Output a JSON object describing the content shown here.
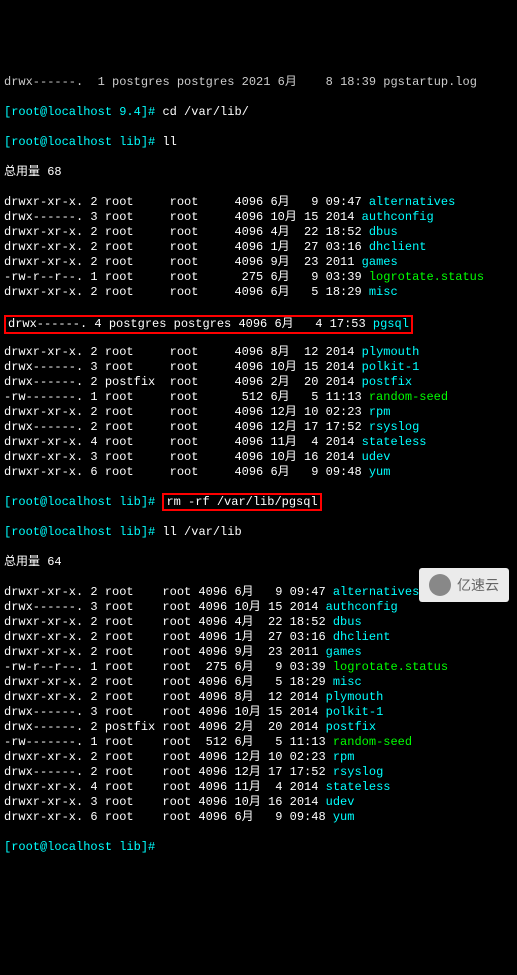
{
  "top_partial": {
    "perm": "drwx------.",
    "n": "1",
    "own": "postgres",
    "grp": "postgres",
    "date": "2021 6月    8 18:39",
    "file": "pgstartup.log"
  },
  "prompts": {
    "p0": "[root@localhost 9.4]#",
    "p1": "[root@localhost lib]#",
    "cmd_cd": "cd /var/lib/",
    "cmd_ll1": "ll",
    "cmd_rm": "rm -rf /var/lib/pgsql",
    "cmd_ll2": "ll /var/lib"
  },
  "totals": {
    "t1": "总用量 68",
    "t2": "总用量 64"
  },
  "list1": [
    {
      "perm": "drwxr-xr-x.",
      "n": "2",
      "own": "root",
      "grp": "root",
      "sz": "4096",
      "date": "6月   9 09:47",
      "file": "alternatives",
      "cls": "cyan"
    },
    {
      "perm": "drwx------.",
      "n": "3",
      "own": "root",
      "grp": "root",
      "sz": "4096",
      "date": "10月 15 2014",
      "file": "authconfig",
      "cls": "cyan"
    },
    {
      "perm": "drwxr-xr-x.",
      "n": "2",
      "own": "root",
      "grp": "root",
      "sz": "4096",
      "date": "4月  22 18:52",
      "file": "dbus",
      "cls": "cyan"
    },
    {
      "perm": "drwxr-xr-x.",
      "n": "2",
      "own": "root",
      "grp": "root",
      "sz": "4096",
      "date": "1月  27 03:16",
      "file": "dhclient",
      "cls": "cyan"
    },
    {
      "perm": "drwxr-xr-x.",
      "n": "2",
      "own": "root",
      "grp": "root",
      "sz": "4096",
      "date": "9月  23 2011",
      "file": "games",
      "cls": "cyan"
    },
    {
      "perm": "-rw-r--r--.",
      "n": "1",
      "own": "root",
      "grp": "root",
      "sz": "275",
      "date": "6月   9 03:39",
      "file": "logrotate.status",
      "cls": "green"
    },
    {
      "perm": "drwxr-xr-x.",
      "n": "2",
      "own": "root",
      "grp": "root",
      "sz": "4096",
      "date": "6月   5 18:29",
      "file": "misc",
      "cls": "cyan"
    }
  ],
  "pgsql": {
    "perm": "drwx------.",
    "n": "4",
    "own": "postgres",
    "grp": "postgres",
    "sz": "4096",
    "date": "6月   4 17:53",
    "file": "pgsql",
    "cls": "cyan"
  },
  "list1b": [
    {
      "perm": "drwxr-xr-x.",
      "n": "2",
      "own": "root",
      "grp": "root",
      "sz": "4096",
      "date": "8月  12 2014",
      "file": "plymouth",
      "cls": "cyan"
    },
    {
      "perm": "drwx------.",
      "n": "3",
      "own": "root",
      "grp": "root",
      "sz": "4096",
      "date": "10月 15 2014",
      "file": "polkit-1",
      "cls": "cyan"
    },
    {
      "perm": "drwx------.",
      "n": "2",
      "own": "postfix",
      "grp": "root",
      "sz": "4096",
      "date": "2月  20 2014",
      "file": "postfix",
      "cls": "cyan"
    },
    {
      "perm": "-rw-------.",
      "n": "1",
      "own": "root",
      "grp": "root",
      "sz": "512",
      "date": "6月   5 11:13",
      "file": "random-seed",
      "cls": "green"
    },
    {
      "perm": "drwxr-xr-x.",
      "n": "2",
      "own": "root",
      "grp": "root",
      "sz": "4096",
      "date": "12月 10 02:23",
      "file": "rpm",
      "cls": "cyan"
    },
    {
      "perm": "drwx------.",
      "n": "2",
      "own": "root",
      "grp": "root",
      "sz": "4096",
      "date": "12月 17 17:52",
      "file": "rsyslog",
      "cls": "cyan"
    },
    {
      "perm": "drwxr-xr-x.",
      "n": "4",
      "own": "root",
      "grp": "root",
      "sz": "4096",
      "date": "11月  4 2014",
      "file": "stateless",
      "cls": "cyan"
    },
    {
      "perm": "drwxr-xr-x.",
      "n": "3",
      "own": "root",
      "grp": "root",
      "sz": "4096",
      "date": "10月 16 2014",
      "file": "udev",
      "cls": "cyan"
    },
    {
      "perm": "drwxr-xr-x.",
      "n": "6",
      "own": "root",
      "grp": "root",
      "sz": "4096",
      "date": "6月   9 09:48",
      "file": "yum",
      "cls": "cyan"
    }
  ],
  "list2": [
    {
      "perm": "drwxr-xr-x.",
      "n": "2",
      "own": "root",
      "grp": "root",
      "sz": "4096",
      "date": "6月   9 09:47",
      "file": "alternatives",
      "cls": "cyan"
    },
    {
      "perm": "drwx------.",
      "n": "3",
      "own": "root",
      "grp": "root",
      "sz": "4096",
      "date": "10月 15 2014",
      "file": "authconfig",
      "cls": "cyan"
    },
    {
      "perm": "drwxr-xr-x.",
      "n": "2",
      "own": "root",
      "grp": "root",
      "sz": "4096",
      "date": "4月  22 18:52",
      "file": "dbus",
      "cls": "cyan"
    },
    {
      "perm": "drwxr-xr-x.",
      "n": "2",
      "own": "root",
      "grp": "root",
      "sz": "4096",
      "date": "1月  27 03:16",
      "file": "dhclient",
      "cls": "cyan"
    },
    {
      "perm": "drwxr-xr-x.",
      "n": "2",
      "own": "root",
      "grp": "root",
      "sz": "4096",
      "date": "9月  23 2011",
      "file": "games",
      "cls": "cyan"
    },
    {
      "perm": "-rw-r--r--.",
      "n": "1",
      "own": "root",
      "grp": "root",
      "sz": "275",
      "date": "6月   9 03:39",
      "file": "logrotate.status",
      "cls": "green"
    },
    {
      "perm": "drwxr-xr-x.",
      "n": "2",
      "own": "root",
      "grp": "root",
      "sz": "4096",
      "date": "6月   5 18:29",
      "file": "misc",
      "cls": "cyan"
    },
    {
      "perm": "drwxr-xr-x.",
      "n": "2",
      "own": "root",
      "grp": "root",
      "sz": "4096",
      "date": "8月  12 2014",
      "file": "plymouth",
      "cls": "cyan"
    },
    {
      "perm": "drwx------.",
      "n": "3",
      "own": "root",
      "grp": "root",
      "sz": "4096",
      "date": "10月 15 2014",
      "file": "polkit-1",
      "cls": "cyan"
    },
    {
      "perm": "drwx------.",
      "n": "2",
      "own": "postfix",
      "grp": "root",
      "sz": "4096",
      "date": "2月  20 2014",
      "file": "postfix",
      "cls": "cyan"
    },
    {
      "perm": "-rw-------.",
      "n": "1",
      "own": "root",
      "grp": "root",
      "sz": "512",
      "date": "6月   5 11:13",
      "file": "random-seed",
      "cls": "green"
    },
    {
      "perm": "drwxr-xr-x.",
      "n": "2",
      "own": "root",
      "grp": "root",
      "sz": "4096",
      "date": "12月 10 02:23",
      "file": "rpm",
      "cls": "cyan"
    },
    {
      "perm": "drwx------.",
      "n": "2",
      "own": "root",
      "grp": "root",
      "sz": "4096",
      "date": "12月 17 17:52",
      "file": "rsyslog",
      "cls": "cyan"
    },
    {
      "perm": "drwxr-xr-x.",
      "n": "4",
      "own": "root",
      "grp": "root",
      "sz": "4096",
      "date": "11月  4 2014",
      "file": "stateless",
      "cls": "cyan"
    },
    {
      "perm": "drwxr-xr-x.",
      "n": "3",
      "own": "root",
      "grp": "root",
      "sz": "4096",
      "date": "10月 16 2014",
      "file": "udev",
      "cls": "cyan"
    },
    {
      "perm": "drwxr-xr-x.",
      "n": "6",
      "own": "root",
      "grp": "root",
      "sz": "4096",
      "date": "6月   9 09:48",
      "file": "yum",
      "cls": "cyan"
    }
  ],
  "watermark": "亿速云"
}
